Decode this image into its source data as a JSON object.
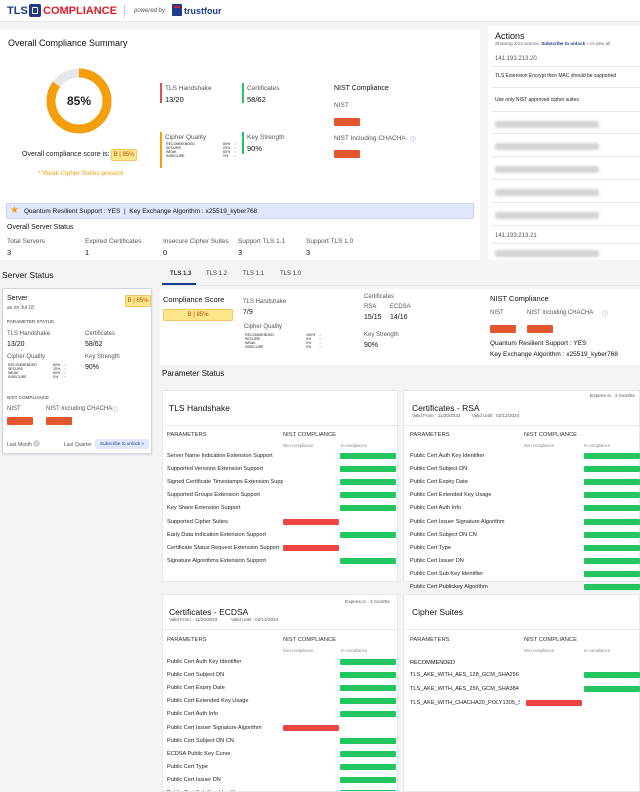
{
  "brand": {
    "product": "TLS COMPLIANCE",
    "powered_by": "powered by",
    "vendor": "trustfour"
  },
  "summary": {
    "title": "Overall Compliance Summary",
    "score": "85%",
    "score_pct": 85,
    "score_label": "Overall compliance score is:",
    "score_badge": "B | 85%",
    "weak_note": "* Weak Cipher Suites present",
    "tls_handshake_label": "TLS Handshake",
    "tls_handshake_value": "13/20",
    "certificates_label": "Certificates",
    "certificates_value": "58/62",
    "cipher_quality_label": "Cipher Quality",
    "cipher_quality": [
      {
        "name": "RECOMMENDED",
        "pct": "60%"
      },
      {
        "name": "SECURE",
        "pct": "20%"
      },
      {
        "name": "WEAK",
        "pct": "60%"
      },
      {
        "name": "INSECURE",
        "pct": "0%"
      }
    ],
    "key_strength_label": "Key Strength",
    "key_strength_value": "90%",
    "nist_title": "NIST Compliance",
    "nist_label": "NIST",
    "nist_chacha_label": "NIST Including CHACHA",
    "quantum_text": "Quantum Resilient Support : YES  |  Key Exchange Algorithm : x25519_kyber768",
    "server_status_title": "Overall Server Status",
    "stats": [
      {
        "label": "Total Servers",
        "value": "3"
      },
      {
        "label": "Expired Certificates",
        "value": "1"
      },
      {
        "label": "Insecure Cipher Suites",
        "value": "0"
      },
      {
        "label": "Support TLS 1.1",
        "value": "3"
      },
      {
        "label": "Support TLS 1.0",
        "value": "3"
      }
    ]
  },
  "actions": {
    "title": "Actions",
    "subtitle_pre": "Showing 2/14 actions.",
    "subtitle_link": "Subscribe to unlock",
    "subtitle_post": "» to view all",
    "ip1": "141.193.213.20",
    "item1": "TLS Extension Encrypt then MAC should be supported",
    "item2": "Use only NIST approved cipher suites",
    "locked": "Subscribe to unlock Subscribe to unlock",
    "ip2": "141.193.213.21"
  },
  "server_status": {
    "title": "Server Status",
    "server_label": "Server",
    "server_date": "as on Jul 18",
    "server_badge": "B | 85%",
    "param_status": "PARAMETER STATUS",
    "tls_handshake_label": "TLS Handshake",
    "tls_handshake_value": "13/20",
    "certificates_label": "Certificates",
    "certificates_value": "58/62",
    "cipher_quality_label": "Cipher Quality",
    "cipher_quality": [
      {
        "name": "RECOMMENDED",
        "pct": "60%"
      },
      {
        "name": "SECURE",
        "pct": "20%"
      },
      {
        "name": "WEAK",
        "pct": "60%"
      },
      {
        "name": "INSECURE",
        "pct": "0%"
      }
    ],
    "key_strength_label": "Key Strength",
    "key_strength_value": "90%",
    "nist_compliance": "NIST COMPLIANCE",
    "nist_label": "NIST",
    "nist_chacha_label": "NIST Including CHACHA",
    "last_month": "Last Month",
    "last_quarter": "Last Quarter",
    "subscribe": "Subscribe to unlock »"
  },
  "tabs": [
    "TLS 1.3",
    "TLS 1.2",
    "TLS 1.1",
    "TLS 1.0"
  ],
  "detail": {
    "compliance_score_label": "Compliance Score",
    "badge": "B | 85%",
    "tls_handshake_label": "TLS Handshake",
    "tls_handshake_value": "7/9",
    "certificates_label": "Certificates",
    "rsa_label": "RSA",
    "rsa_value": "15/15",
    "ecdsa_label": "ECDSA",
    "ecdsa_value": "14/16",
    "cipher_quality_label": "Cipher Quality",
    "cipher_quality": [
      {
        "name": "RECOMMENDED",
        "pct": "100%"
      },
      {
        "name": "SECURE",
        "pct": "0%"
      },
      {
        "name": "WEAK",
        "pct": "0%"
      },
      {
        "name": "INSECURE",
        "pct": "0%"
      }
    ],
    "key_strength_label": "Key Strength",
    "key_strength_value": "90%",
    "nist_title": "NIST Compliance",
    "nist_label": "NIST",
    "nist_chacha_label": "NIST Including CHACHA",
    "quantum": "Quantum Resilient Support : YES",
    "kex": "Key Exchange Algorithm : x25519_kyber768"
  },
  "param_status_title": "Parameter Status",
  "columns": {
    "parameters": "PARAMETERS",
    "nist": "NIST COMPLIANCE",
    "non": "Non-compliance",
    "in": "In-compliance"
  },
  "tls_handshake_panel": {
    "title": "TLS Handshake",
    "rows": [
      {
        "name": "Server Name Indication Extension Support",
        "ok": true
      },
      {
        "name": "Supported Versions Extension Support",
        "ok": true
      },
      {
        "name": "Signed Certificate Timestamps Extension Support",
        "ok": true
      },
      {
        "name": "Supported Groups Extension Support",
        "ok": true
      },
      {
        "name": "Key Share Extension Support",
        "ok": true
      },
      {
        "name": "Supported Cipher Suites",
        "ok": false
      },
      {
        "name": "Early Data Indication Extension Support",
        "ok": true
      },
      {
        "name": "Certificate Status Request Extension Support",
        "ok": false
      },
      {
        "name": "Signature Algorithms Extension Support",
        "ok": true
      }
    ]
  },
  "rsa_panel": {
    "title": "Certificates - RSA",
    "expires": "Expires in : 2 months",
    "valid_from": "Valid From : 11/20/2023",
    "valid_until": "Valid Until : 02/12/2024",
    "rows": [
      {
        "name": "Public Cert Auth Key Identifier",
        "ok": true
      },
      {
        "name": "Public Cert Subject DN",
        "ok": true
      },
      {
        "name": "Public Cert Expiry Date",
        "ok": true
      },
      {
        "name": "Public Cert Extended Key Usage",
        "ok": true
      },
      {
        "name": "Public Cert Auth Info",
        "ok": true
      },
      {
        "name": "Public Cert Issuer Signature Algorithm",
        "ok": true
      },
      {
        "name": "Public Cert Subject DN CN",
        "ok": true
      },
      {
        "name": "Public Cert Type",
        "ok": true
      },
      {
        "name": "Public Cert Issuer DN",
        "ok": true
      },
      {
        "name": "Public Cert Sub Key Identifier",
        "ok": true
      },
      {
        "name": "Public Cert Publickey Algorithm",
        "ok": true
      }
    ]
  },
  "ecdsa_panel": {
    "title": "Certificates - ECDSA",
    "expires": "Expires in : 2 months",
    "valid_from": "Valid From : 11/20/2023",
    "valid_until": "Valid Until : 02/12/2024",
    "rows": [
      {
        "name": "Public Cert Auth Key Identifier",
        "ok": true
      },
      {
        "name": "Public Cert Subject DN",
        "ok": true
      },
      {
        "name": "Public Cert Expiry Date",
        "ok": true
      },
      {
        "name": "Public Cert Extended Key Usage",
        "ok": true
      },
      {
        "name": "Public Cert Auth Info",
        "ok": true
      },
      {
        "name": "Public Cert Issuer Signature Algorithm",
        "ok": false
      },
      {
        "name": "Public Cert Subject DN CN",
        "ok": true
      },
      {
        "name": "ECDSA Public Key Curve",
        "ok": true
      },
      {
        "name": "Public Cert Type",
        "ok": true
      },
      {
        "name": "Public Cert Issuer DN",
        "ok": true
      },
      {
        "name": "Public Cert Sub Key Identifier",
        "ok": true
      }
    ]
  },
  "cipher_panel": {
    "title": "Cipher Suites",
    "recommended": "RECOMMENDED",
    "rows": [
      {
        "name": "TLS_AKE_WITH_AES_128_GCM_SHA256",
        "ok": true
      },
      {
        "name": "TLS_AKE_WITH_AES_256_GCM_SHA384",
        "ok": true
      },
      {
        "name": "TLS_AKE_WITH_CHACHA20_POLY1305_SHA256",
        "ok": false
      }
    ]
  },
  "colors": {
    "accent": "#f59e0b",
    "red": "#ef4444",
    "green": "#22c55e",
    "brand_red": "#e11d2a",
    "navy": "#1e3a8a"
  }
}
